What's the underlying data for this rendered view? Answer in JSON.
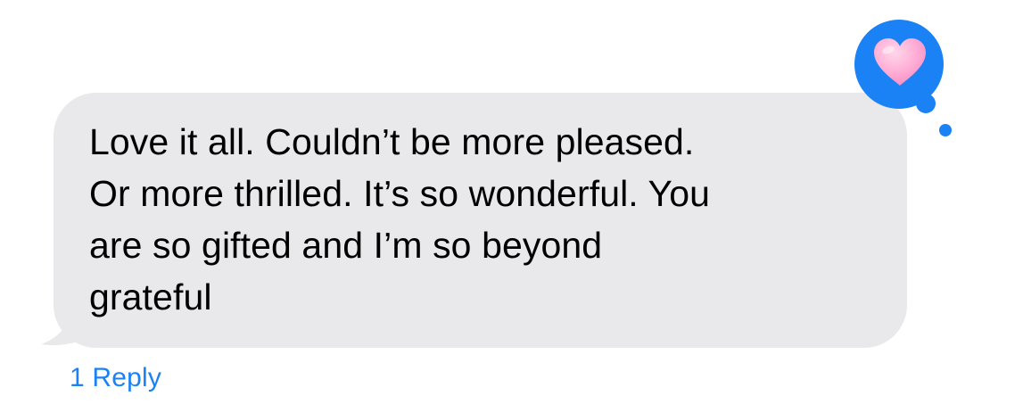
{
  "message": {
    "direction": "incoming",
    "text": "Love it all.  Couldn’t be more pleased.\nOr more thrilled. It’s so wonderful. You\nare so gifted and I’m so beyond\ngrateful",
    "bubble_color": "#e9e9eb",
    "text_color": "#000000"
  },
  "tapback": {
    "icon": "heart-icon",
    "badge_color": "#1b82f5",
    "heart_color": "#ffa8d4"
  },
  "replies": {
    "label": "1 Reply",
    "color": "#1b82f5"
  }
}
